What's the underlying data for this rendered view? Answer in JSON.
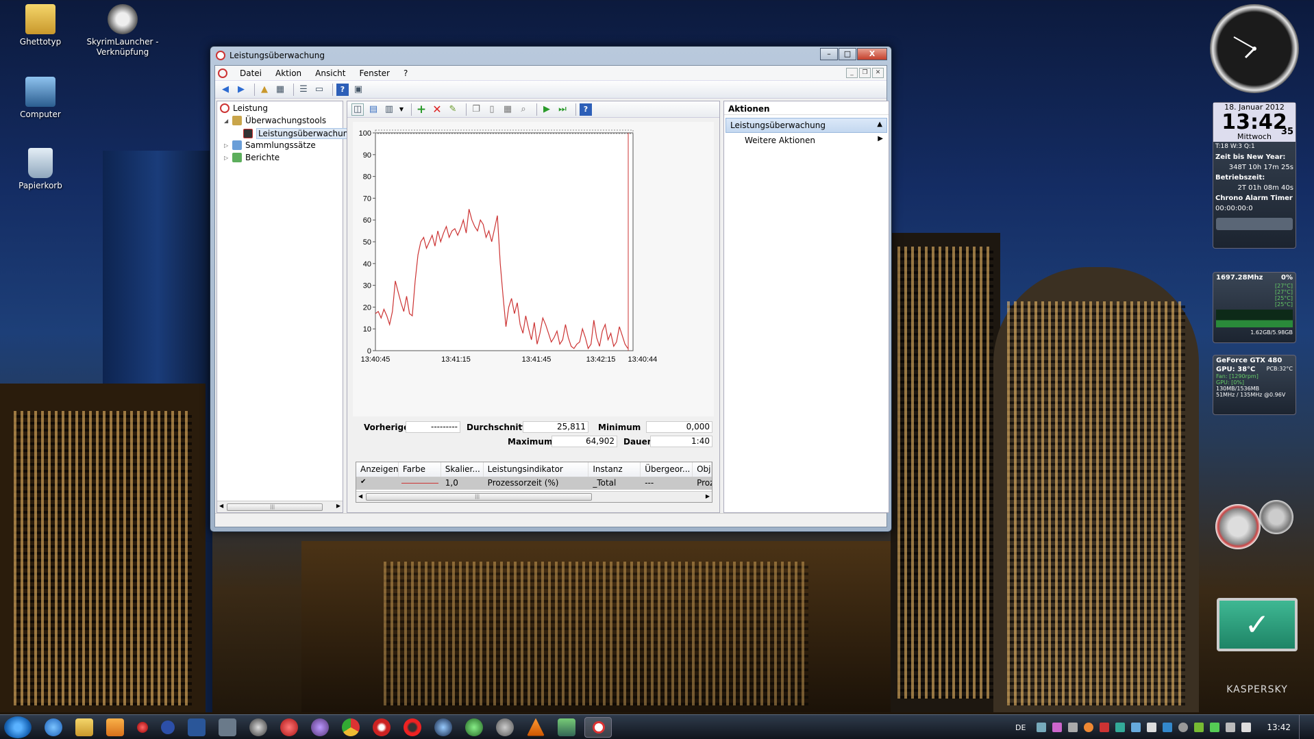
{
  "desktop": {
    "icons": [
      {
        "label": "Ghettotyp"
      },
      {
        "label": "SkyrimLauncher - Verknüpfung"
      },
      {
        "label": "Computer"
      },
      {
        "label": "Papierkorb"
      }
    ]
  },
  "window": {
    "title": "Leistungsüberwachung",
    "controls": {
      "minimize": "–",
      "maximize": "□",
      "close": "X"
    }
  },
  "menu": {
    "items": [
      "Datei",
      "Aktion",
      "Ansicht",
      "Fenster",
      "?"
    ]
  },
  "tree": {
    "root": "Leistung",
    "items": [
      {
        "label": "Überwachungstools"
      },
      {
        "label": "Leistungsüberwachung"
      },
      {
        "label": "Sammlungssätze"
      },
      {
        "label": "Berichte"
      }
    ],
    "scroll_mark": "|||"
  },
  "chart_data": {
    "type": "line",
    "x": [
      "13:40:45",
      "13:40:47",
      "13:40:48",
      "13:40:49",
      "13:40:50",
      "13:40:51",
      "13:40:52",
      "13:40:53",
      "13:40:54",
      "13:40:55",
      "13:40:56",
      "13:40:57",
      "13:40:58",
      "13:40:59",
      "13:41:00",
      "13:41:01",
      "13:41:02",
      "13:41:03",
      "13:41:04",
      "13:41:05",
      "13:41:06",
      "13:41:07",
      "13:41:08",
      "13:41:09",
      "13:41:10",
      "13:41:11",
      "13:41:12",
      "13:41:13",
      "13:41:14",
      "13:41:15",
      "13:41:16",
      "13:41:17",
      "13:41:18",
      "13:41:19",
      "13:41:20",
      "13:41:21",
      "13:41:22",
      "13:41:23",
      "13:41:24",
      "13:41:25",
      "13:41:26",
      "13:41:27",
      "13:41:28",
      "13:41:29",
      "13:41:30",
      "13:41:31",
      "13:41:32",
      "13:41:33",
      "13:41:34",
      "13:41:35",
      "13:41:36",
      "13:41:37",
      "13:41:38",
      "13:41:39",
      "13:41:40",
      "13:41:41",
      "13:41:42",
      "13:41:43",
      "13:41:44",
      "13:41:45",
      "13:41:46",
      "13:41:47",
      "13:41:48",
      "13:41:49",
      "13:41:50",
      "13:41:51",
      "13:41:52",
      "13:41:53",
      "13:41:54",
      "13:41:55",
      "13:41:56",
      "13:41:57",
      "13:41:58",
      "13:41:59",
      "13:42:00",
      "13:42:01",
      "13:42:02",
      "13:42:03",
      "13:42:04",
      "13:42:05",
      "13:42:06",
      "13:42:07",
      "13:42:08",
      "13:42:09",
      "13:42:10",
      "13:42:11",
      "13:42:12",
      "13:42:13",
      "13:42:14",
      "13:42:15"
    ],
    "values": [
      17,
      18,
      15,
      19,
      16,
      12,
      18,
      32,
      27,
      22,
      18,
      25,
      17,
      16,
      32,
      44,
      50,
      52,
      47,
      50,
      53,
      48,
      55,
      50,
      54,
      57,
      52,
      55,
      56,
      53,
      56,
      60,
      54,
      65,
      60,
      57,
      55,
      60,
      58,
      52,
      55,
      50,
      56,
      62,
      40,
      25,
      11,
      20,
      24,
      17,
      22,
      12,
      8,
      16,
      10,
      5,
      13,
      3,
      8,
      15,
      12,
      8,
      4,
      6,
      9,
      3,
      5,
      12,
      6,
      2,
      1,
      3,
      4,
      10,
      6,
      1,
      3,
      14,
      6,
      2,
      9,
      12,
      5,
      8,
      2,
      4,
      11,
      7,
      3,
      1
    ],
    "ylim": [
      0,
      100
    ],
    "yticks": [
      "100",
      "90",
      "80",
      "70",
      "60",
      "50",
      "40",
      "30",
      "20",
      "10",
      "0"
    ],
    "xticks": [
      "13:40:45",
      "13:41:15",
      "13:41:45",
      "13:42:15",
      "13:40:44"
    ],
    "grid": false,
    "line_color": "#cc3333"
  },
  "stats": {
    "vorherige_label": "Vorherige",
    "vorherige": "---------",
    "durchschnitt_label": "Durchschnitt",
    "durchschnitt": "25,811",
    "minimum_label": "Minimum",
    "minimum": "0,000",
    "maximum_label": "Maximum",
    "maximum": "64,902",
    "dauer_label": "Dauer",
    "dauer": "1:40"
  },
  "counters": {
    "headers": [
      "Anzeigen",
      "Farbe",
      "Skalier...",
      "Leistungsindikator",
      "Instanz",
      "Übergeor...",
      "Obje"
    ],
    "row": {
      "checked": "✔",
      "scale": "1,0",
      "counter": "Prozessorzeit (%)",
      "instance": "_Total",
      "parent": "---",
      "object": "Proz"
    },
    "scroll_mark": "|||"
  },
  "actions": {
    "header": "Aktionen",
    "section": "Leistungsüberwachung",
    "item": "Weitere Aktionen"
  },
  "gadgets": {
    "date": "18. Januar 2012",
    "time": "13:42",
    "seconds": "35",
    "weekday": "Mittwoch",
    "info": "T:18   W:3   Q:1",
    "newyear_label": "Zeit bis New Year:",
    "newyear_value": "348T 10h 17m 25s",
    "uptime_label": "Betriebszeit:",
    "uptime_value": "2T 01h 08m 40s",
    "tabs": "Chrono  Alarm  Timer",
    "chrono": "00:00:00:0",
    "cpu_freq": "1697.28Mhz",
    "cpu_load": "0%",
    "cpu_temps": [
      "[27°C]",
      "[27°C]",
      "[25°C]",
      "[25°C]"
    ],
    "cpu_mem": "1.62GB/5.98GB",
    "gpu_name": "GeForce GTX 480",
    "gpu_temp": "GPU: 38°C",
    "gpu_pcb": "PCB:32°C",
    "gpu_fan": "Fan: [1290rpm]",
    "gpu_load": "GPU: [0%]",
    "gpu_mem": "130MB/1536MB",
    "gpu_clock": "51MHz / 135MHz @0.96V",
    "kaspersky": "KASPERSKY"
  },
  "taskbar": {
    "lang": "DE",
    "clock": "13:42"
  },
  "colors": {
    "accent": "#cc3333",
    "selection": "#c4d8f0"
  }
}
